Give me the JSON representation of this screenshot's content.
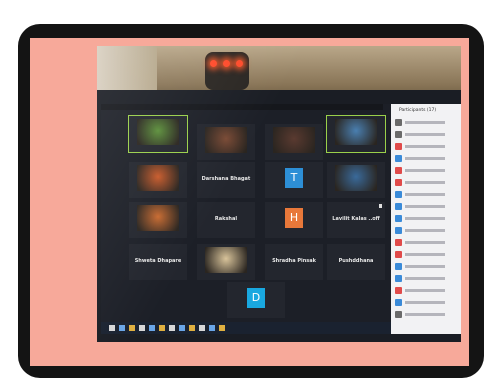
{
  "photo": {
    "gallery": [
      {
        "label": "",
        "caption": "",
        "type": "video",
        "color": "#5b8f3a"
      },
      {
        "label": "",
        "caption": "",
        "type": "photo",
        "color": "#7a4a35"
      },
      {
        "label": "",
        "caption": "",
        "type": "photo",
        "color": "#5a3a30"
      },
      {
        "label": "",
        "caption": "",
        "type": "video",
        "color": "#4a7fb0"
      },
      {
        "label": "",
        "caption": "",
        "type": "photo",
        "color": "#c85a2a"
      },
      {
        "label": "Darshana Bhagat",
        "caption": "",
        "type": "name",
        "color": ""
      },
      {
        "label": "T",
        "caption": "",
        "type": "avatar",
        "color": "#2d8fd6"
      },
      {
        "label": "",
        "caption": "",
        "type": "photo",
        "color": "#3a6a9a"
      },
      {
        "label": "",
        "caption": "",
        "type": "photo",
        "color": "#c86a30"
      },
      {
        "label": "Rakshal",
        "caption": "",
        "type": "name",
        "color": ""
      },
      {
        "label": "H",
        "caption": "",
        "type": "avatar",
        "color": "#e8783a"
      },
      {
        "label": "Lavilit Kalas ..off",
        "caption": "",
        "type": "name",
        "color": ""
      },
      {
        "label": "Shweta Dhapare",
        "caption": "",
        "type": "name",
        "color": ""
      },
      {
        "label": "",
        "caption": "",
        "type": "photo",
        "color": "#d8c39a"
      },
      {
        "label": "Shradha Pinsak",
        "caption": "",
        "type": "name",
        "color": ""
      },
      {
        "label": "Pushddhana",
        "caption": "",
        "type": "name",
        "color": ""
      },
      {
        "label": "D",
        "caption": "",
        "type": "avatar",
        "color": "#19a8e0"
      }
    ],
    "sidebar": {
      "header": "Participants (17)",
      "rows": [
        "#6a6a6a",
        "#6a6a6a",
        "#e04a4a",
        "#3a8ad8",
        "#e04a4a",
        "#e04a4a",
        "#3a8ad8",
        "#3a8ad8",
        "#3a8ad8",
        "#3a8ad8",
        "#e04a4a",
        "#e04a4a",
        "#3a8ad8",
        "#3a8ad8",
        "#e04a4a",
        "#3a8ad8",
        "#6a6a6a"
      ]
    }
  }
}
